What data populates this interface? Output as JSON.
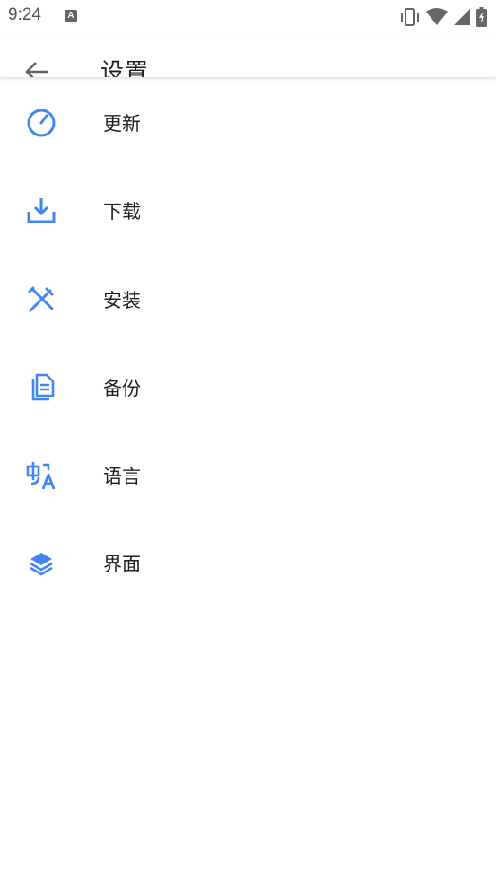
{
  "status_bar": {
    "time": "9:24",
    "notification_icon": "A",
    "icons": [
      "vibrate-icon",
      "wifi-icon",
      "cellular-icon",
      "battery-charging-icon"
    ]
  },
  "app_bar": {
    "back_icon": "arrow-back-icon",
    "title": "设置"
  },
  "colors": {
    "accent": "#4285F4",
    "text": "#202124"
  },
  "settings": {
    "items": [
      {
        "label": "更新",
        "icon": "update-icon"
      },
      {
        "label": "下载",
        "icon": "download-icon"
      },
      {
        "label": "安装",
        "icon": "install-tools-icon"
      },
      {
        "label": "备份",
        "icon": "backup-icon"
      },
      {
        "label": "语言",
        "icon": "language-icon"
      },
      {
        "label": "界面",
        "icon": "layers-icon"
      }
    ]
  }
}
